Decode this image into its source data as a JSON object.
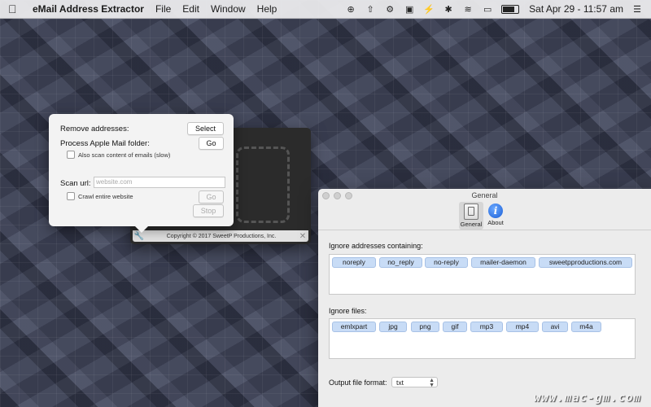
{
  "menubar": {
    "apple_icon": "apple-icon",
    "app_name": "eMail Address Extractor",
    "menus": [
      "File",
      "Edit",
      "Window",
      "Help"
    ],
    "clock": "Sat Apr 29 - 11:57 am",
    "tray_icons": [
      "flux-icon",
      "upload-icon",
      "gear-icon",
      "lastpass-icon",
      "bolt-icon",
      "bluetooth-icon",
      "wifi-icon",
      "airplay-icon",
      "battery-icon",
      "menu-list-icon"
    ]
  },
  "popover": {
    "remove_label": "Remove addresses:",
    "select_button": "Select",
    "process_label": "Process Apple Mail folder:",
    "go_button": "Go",
    "scan_content_label": "Also scan content of emails (slow)",
    "scan_url_label": "Scan url:",
    "url_placeholder": "website.com",
    "crawl_label": "Crawl entire website",
    "go_disabled_button": "Go",
    "stop_button": "Stop"
  },
  "dropwin": {
    "copyright": "Copyright © 2017 SweetP Productions, Inc."
  },
  "prefs": {
    "title": "General",
    "tabs": [
      {
        "label": "General",
        "icon": "general-switch-icon"
      },
      {
        "label": "About",
        "icon": "info-icon"
      }
    ],
    "ignore_addresses_label": "Ignore addresses containing:",
    "ignore_addresses": [
      "noreply",
      "no_reply",
      "no-reply",
      "mailer-daemon",
      "sweetpproductions.com"
    ],
    "ignore_files_label": "Ignore files:",
    "ignore_files": [
      "emlxpart",
      "jpg",
      "png",
      "gif",
      "mp3",
      "mp4",
      "avi",
      "m4a"
    ],
    "output_format_label": "Output file format:",
    "output_format_value": "txt"
  },
  "watermark": "www.mac-gm.com"
}
